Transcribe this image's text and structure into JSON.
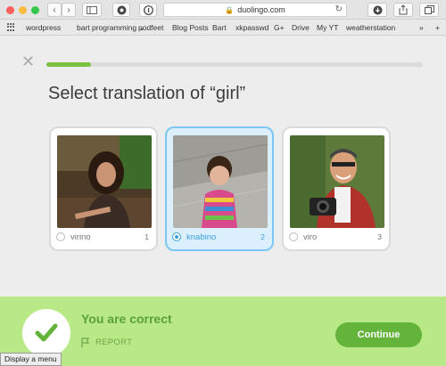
{
  "browser": {
    "address": "duolingo.com",
    "bookmarks": [
      "wordpress",
      "bart programming ⌄",
      "podfeet",
      "Blog Posts",
      "Bart",
      "xkpasswd",
      "G+",
      "Drive",
      "My YT",
      "weatherstation"
    ],
    "overflow": "»",
    "add_tab": "+"
  },
  "lesson": {
    "progress": 0.12,
    "question": "Select translation of “girl”",
    "choices": [
      {
        "word": "virino",
        "number": "1",
        "selected": false
      },
      {
        "word": "knabino",
        "number": "2",
        "selected": true
      },
      {
        "word": "viro",
        "number": "3",
        "selected": false
      }
    ]
  },
  "feedback": {
    "message": "You are correct",
    "report": "REPORT",
    "continue": "Continue"
  },
  "tooltip": "Display a menu",
  "colors": {
    "accent_green": "#64b33b",
    "footer_bg": "#b8e986",
    "selected_blue": "#3aa0e0"
  }
}
